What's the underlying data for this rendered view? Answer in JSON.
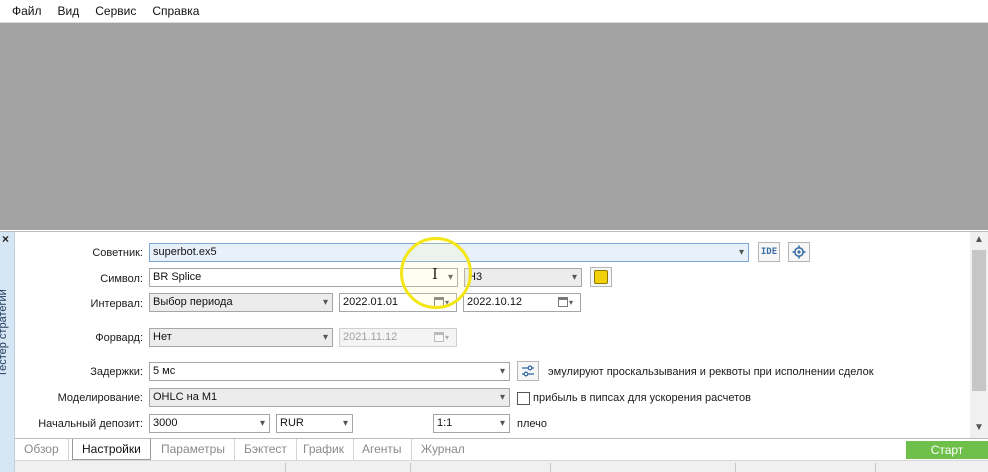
{
  "menu": {
    "items": [
      "Файл",
      "Вид",
      "Сервис",
      "Справка"
    ]
  },
  "panel": {
    "side_label": "Тестер стратегий",
    "close_glyph": "×"
  },
  "settings": {
    "advisor": {
      "label": "Советник:",
      "value": "superbot.ex5"
    },
    "symbol": {
      "label": "Символ:",
      "value": "BR Splice",
      "timeframe": "H3",
      "color": "#f2d10a"
    },
    "interval": {
      "label": "Интервал:",
      "value": "Выбор периода",
      "from": "2022.01.01",
      "to": "2022.10.12"
    },
    "forward": {
      "label": "Форвард:",
      "value": "Нет",
      "date": "2021.11.12"
    },
    "delays": {
      "label": "Задержки:",
      "value": "5 мс",
      "note": "эмулируют проскальзывания и реквоты при исполнении сделок"
    },
    "modeling": {
      "label": "Моделирование:",
      "value": "OHLC на M1",
      "checkbox_label": "прибыль в пипсах для ускорения расчетов"
    },
    "deposit": {
      "label": "Начальный депозит:",
      "value": "3000",
      "currency": "RUR",
      "leverage": "1:1",
      "leverage_label": "плечо"
    },
    "ide_label": "IDE"
  },
  "tabs": [
    {
      "label": "Обзор",
      "active": false
    },
    {
      "label": "Настройки",
      "active": true
    },
    {
      "label": "Параметры",
      "active": false
    },
    {
      "label": "Бэктест",
      "active": false
    },
    {
      "label": "График",
      "active": false
    },
    {
      "label": "Агенты",
      "active": false
    },
    {
      "label": "Журнал",
      "active": false
    }
  ],
  "start_button": "Старт",
  "colors": {
    "workspace": "#a3a3a3",
    "start_button": "#6fbf4b",
    "highlight_ring": "#f3e614"
  }
}
